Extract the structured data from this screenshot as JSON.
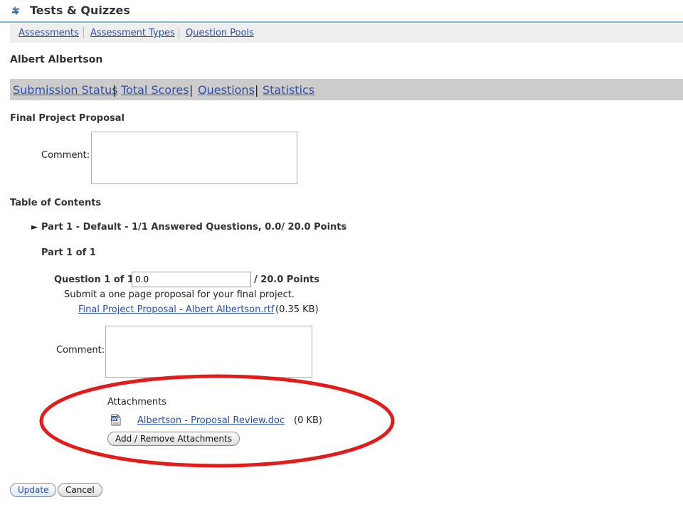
{
  "header": {
    "title": "Tests & Quizzes",
    "icon": "tests-quizzes-icon"
  },
  "nav": {
    "items": [
      "Assessments",
      "Assessment Types",
      "Question Pools"
    ]
  },
  "student_name": "Albert Albertson",
  "sub_nav": {
    "items": [
      "Submission Status",
      "Total Scores",
      "Questions",
      "Statistics"
    ],
    "separator": "|"
  },
  "assessment": {
    "title": "Final Project Proposal",
    "comment_label": "Comment:",
    "comment_value": ""
  },
  "toc": {
    "heading": "Table of Contents",
    "arrow": "►",
    "part_summary": "Part 1 - Default - 1/1 Answered Questions, 0.0/ 20.0 Points",
    "part_label": "Part 1 of 1"
  },
  "question": {
    "label": "Question 1 of 1:",
    "score_value": "0.0",
    "points_suffix": "/ 20.0 Points",
    "prompt": "Submit a one page proposal for your final project.",
    "file_link": "Final Project Proposal - Albert Albertson.rtf",
    "file_size": "(0.35 KB)",
    "comment_label": "Comment:",
    "comment_value": ""
  },
  "attachments": {
    "heading": "Attachments",
    "file_name": "Albertson - Proposal Review.doc",
    "file_size": "(0 KB)",
    "add_remove_label": "Add / Remove Attachments",
    "highlight_color": "#e21b1b"
  },
  "buttons": {
    "update": "Update",
    "cancel": "Cancel"
  },
  "colors": {
    "link": "#2a4fae",
    "nav_bg": "#eeeeee",
    "subnav_bg": "#cccccc",
    "header_rule": "#7fb8d6"
  }
}
